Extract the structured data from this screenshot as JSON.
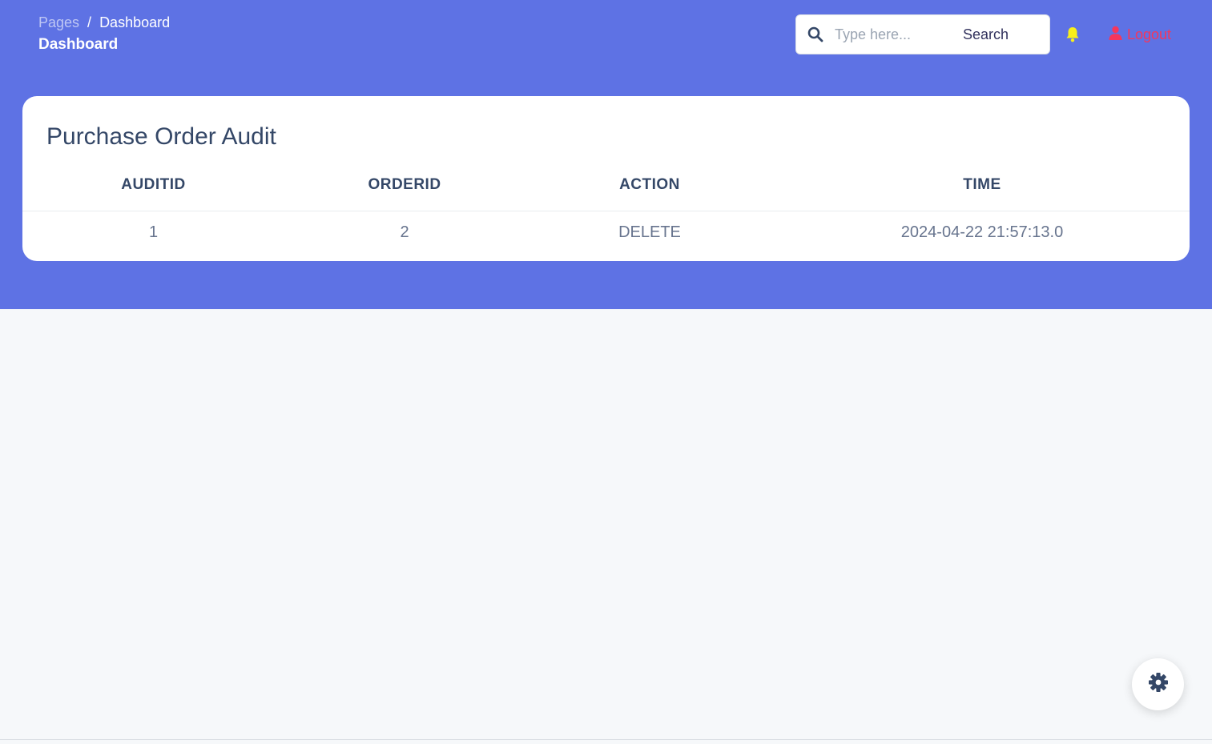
{
  "breadcrumb": {
    "root": "Pages",
    "separator": "/",
    "current": "Dashboard"
  },
  "header": {
    "title": "Dashboard"
  },
  "search": {
    "placeholder": "Type here...",
    "button_label": "Search"
  },
  "nav": {
    "notification_icon": "bell-icon",
    "logout_label": "Logout",
    "logout_icon": "user-icon"
  },
  "card": {
    "title": "Purchase Order Audit",
    "columns": [
      "AUDITID",
      "ORDERID",
      "ACTION",
      "TIME"
    ],
    "rows": [
      [
        "1",
        "2",
        "DELETE",
        "2024-04-22 21:57:13.0"
      ]
    ]
  },
  "fab": {
    "icon": "gear-icon"
  },
  "colors": {
    "hero": "#5e72e4",
    "logout": "#f5365c",
    "bell": "#f8ef1a",
    "text_dark": "#344767"
  }
}
